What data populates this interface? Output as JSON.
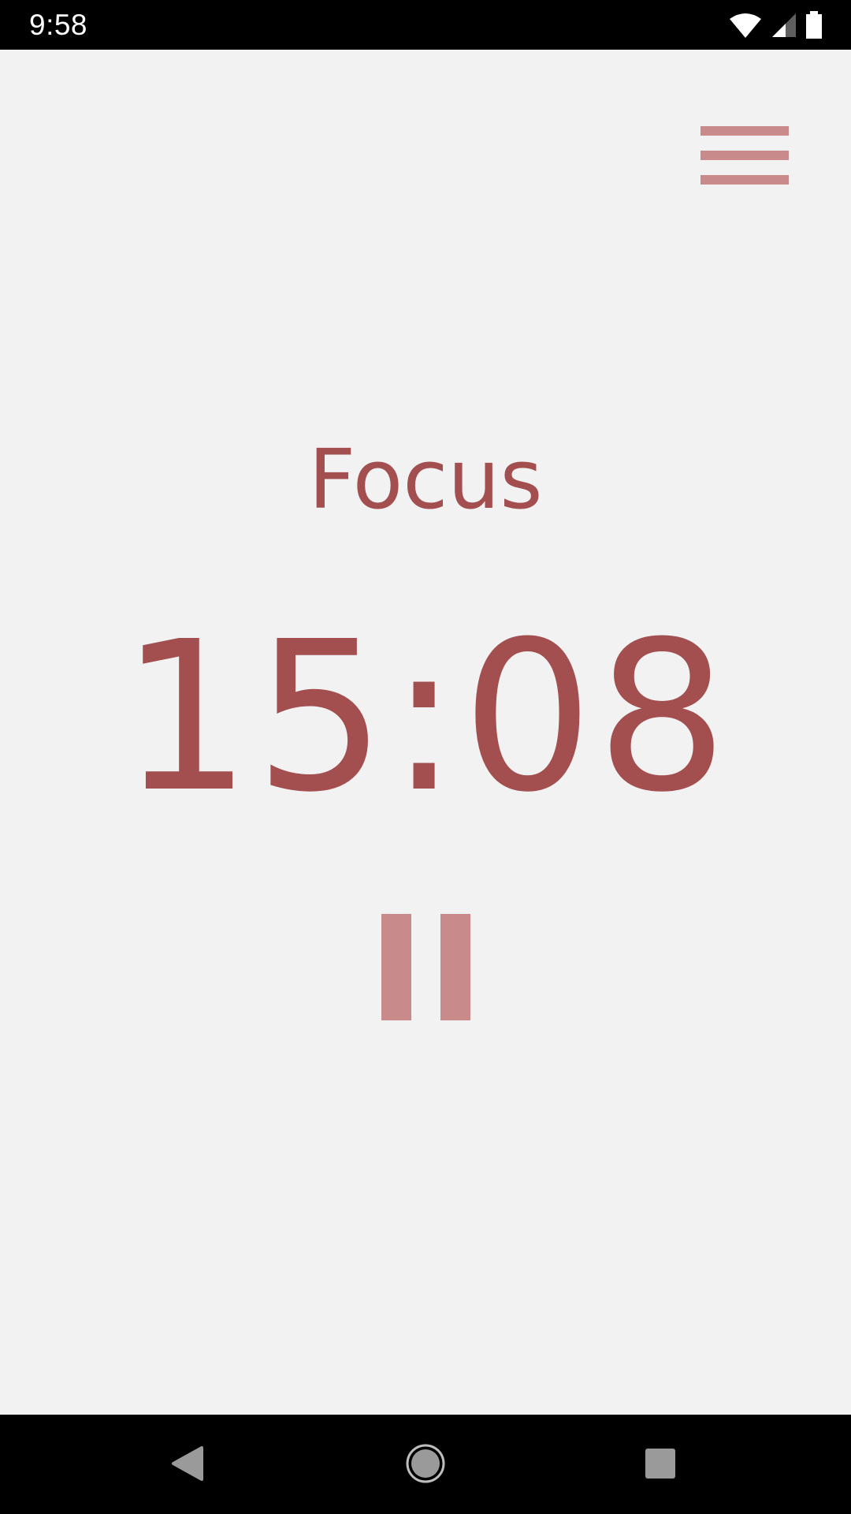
{
  "status_bar": {
    "time": "9:58",
    "icons": [
      "wifi-icon",
      "cellular-signal-icon",
      "battery-icon"
    ]
  },
  "timer_screen": {
    "mode_label": "Focus",
    "time_remaining": "15:08",
    "menu_icon": "hamburger-menu-icon",
    "pause_icon": "pause-icon"
  },
  "nav_bar": {
    "buttons": [
      "back-icon",
      "home-icon",
      "recents-icon"
    ]
  },
  "colors": {
    "accent": "#a34f50",
    "accent_light": "#c98a8c",
    "background": "#f2f2f2",
    "system_bar": "#000000"
  }
}
